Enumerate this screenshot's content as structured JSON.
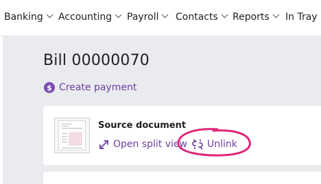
{
  "nav": {
    "items": [
      {
        "label": "Banking"
      },
      {
        "label": "Accounting"
      },
      {
        "label": "Payroll"
      },
      {
        "label": "Contacts"
      },
      {
        "label": "Reports"
      },
      {
        "label": "In Tray"
      }
    ]
  },
  "page": {
    "title": "Bill 00000070",
    "create_payment_label": "Create payment",
    "create_payment_icon": "dollar-circle-icon"
  },
  "source_document": {
    "heading": "Source document",
    "open_split_view_label": "Open split view",
    "open_split_view_icon": "expand-arrows-icon",
    "unlink_label": "Unlink",
    "unlink_icon": "unlink-icon"
  },
  "colors": {
    "accent": "#6c3fa0",
    "highlight": "#e0267a",
    "background": "#e9ebee"
  }
}
